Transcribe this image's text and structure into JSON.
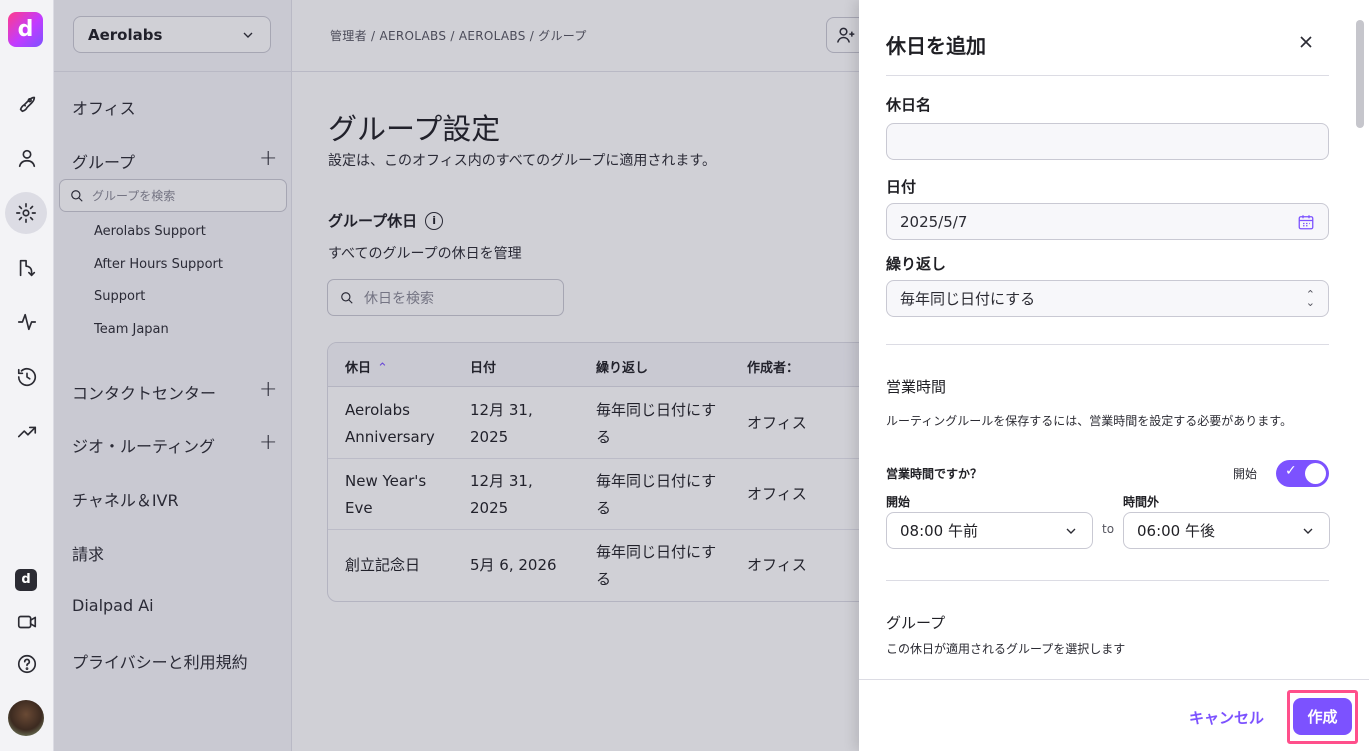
{
  "rail": {
    "logo": "d",
    "icons": [
      "rocket-icon",
      "person-icon",
      "gear-icon",
      "routing-icon",
      "activity-icon",
      "history-icon",
      "trending-icon"
    ],
    "ai_badge": "d",
    "bottom_icons": [
      "video-icon",
      "help-icon"
    ]
  },
  "sidebar": {
    "org": "Aerolabs",
    "office": "オフィス",
    "groups_label": "グループ",
    "group_search_placeholder": "グループを検索",
    "groups": [
      "Aerolabs Support",
      "After Hours Support",
      "Support",
      "Team Japan"
    ],
    "contact_center": "コンタクトセンター",
    "geo_routing": "ジオ・ルーティング",
    "channels": "チャネル＆IVR",
    "billing": "請求",
    "dialpad_ai": "Dialpad Ai",
    "privacy": "プライバシーと利用規約"
  },
  "main": {
    "breadcrumb": "管理者 / AEROLABS / AEROLABS / グループ",
    "title": "グループ設定",
    "subtitle": "設定は、このオフィス内のすべてのグループに適用されます。",
    "section_title": "グループ休日",
    "section_info": "i",
    "section_sub": "すべてのグループの休日を管理",
    "search_placeholder": "休日を検索",
    "table": {
      "headers": [
        "休日",
        "日付",
        "繰り返し",
        "作成者："
      ],
      "sort_indicator": "⌃",
      "rows": [
        {
          "name": "Aerolabs Anniversary",
          "date": "12月 31, 2025",
          "repeat": "毎年同じ日付にする",
          "creator": "オフィス"
        },
        {
          "name": "New Year's Eve",
          "date": "12月 31, 2025",
          "repeat": "毎年同じ日付にする",
          "creator": "オフィス"
        },
        {
          "name": "創立記念日",
          "date": "5月 6, 2026",
          "repeat": "毎年同じ日付にする",
          "creator": "オフィス"
        }
      ]
    }
  },
  "drawer": {
    "title": "休日を追加",
    "name_label": "休日名",
    "name_value": "",
    "date_label": "日付",
    "date_value": "2025/5/7",
    "repeat_label": "繰り返し",
    "repeat_value": "毎年同じ日付にする",
    "hours_title": "営業時間",
    "hours_desc": "ルーティングルールを保存するには、営業時間を設定する必要があります。",
    "hours_question": "営業時間ですか？",
    "toggle_label": "開始",
    "toggle_on": true,
    "start_label": "開始",
    "start_value": "08:00 午前",
    "to_label": "to",
    "end_label": "時間外",
    "end_value": "06:00 午後",
    "group_title": "グループ",
    "group_desc": "この休日が適用されるグループを選択します",
    "cancel": "キャンセル",
    "create": "作成"
  },
  "colors": {
    "accent": "#7c52ff",
    "highlight": "#ff4f8b"
  }
}
